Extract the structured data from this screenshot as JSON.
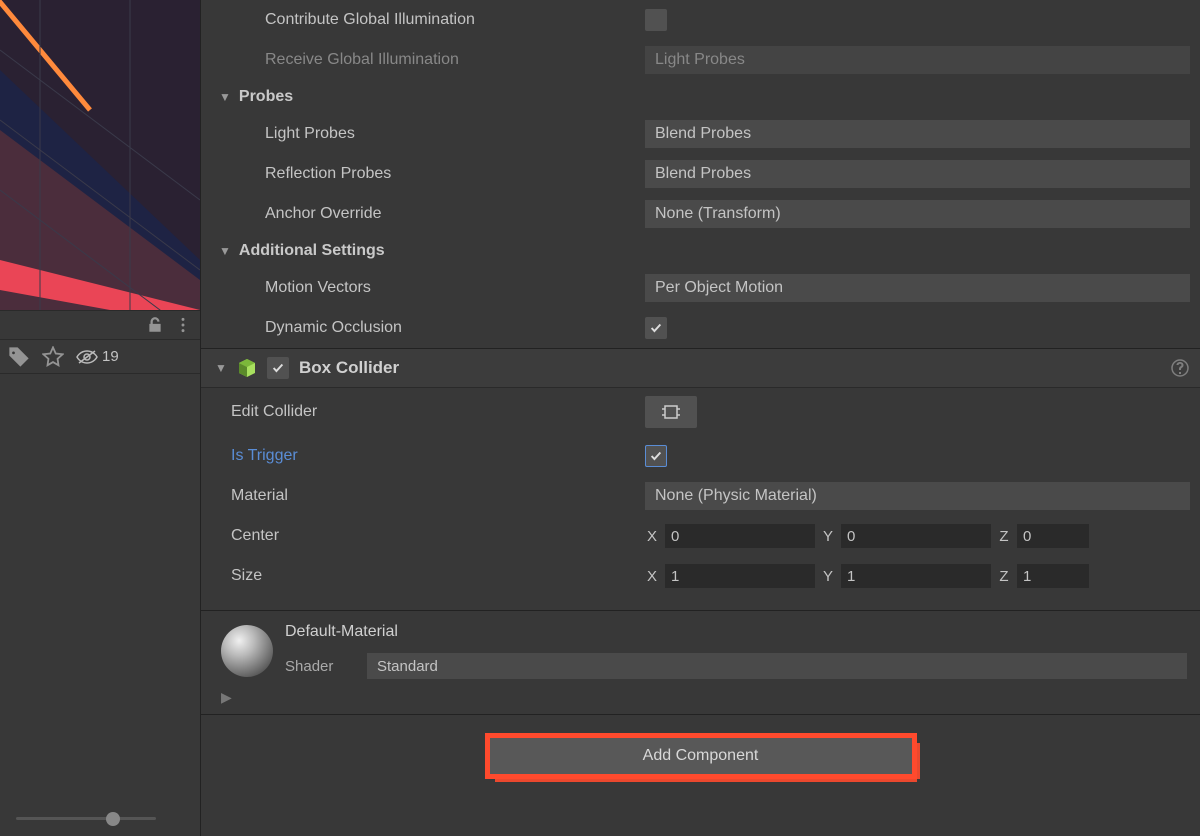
{
  "visibilityBadge": "19",
  "lighting": {
    "contributeGI": "Contribute Global Illumination",
    "receiveGI": "Receive Global Illumination",
    "receiveGIValue": "Light Probes"
  },
  "probes": {
    "title": "Probes",
    "lightProbes": {
      "label": "Light Probes",
      "value": "Blend Probes"
    },
    "reflectionProbes": {
      "label": "Reflection Probes",
      "value": "Blend Probes"
    },
    "anchorOverride": {
      "label": "Anchor Override",
      "value": "None (Transform)"
    }
  },
  "additional": {
    "title": "Additional Settings",
    "motionVectors": {
      "label": "Motion Vectors",
      "value": "Per Object Motion"
    },
    "dynamicOcclusion": {
      "label": "Dynamic Occlusion"
    }
  },
  "boxCollider": {
    "title": "Box Collider",
    "editCollider": "Edit Collider",
    "isTrigger": "Is Trigger",
    "material": {
      "label": "Material",
      "value": "None (Physic Material)"
    },
    "center": {
      "label": "Center",
      "x": "0",
      "y": "0",
      "z": "0"
    },
    "size": {
      "label": "Size",
      "x": "1",
      "y": "1",
      "z": "1"
    },
    "axisX": "X",
    "axisY": "Y",
    "axisZ": "Z"
  },
  "material": {
    "name": "Default-Material",
    "shaderLabel": "Shader",
    "shaderValue": "Standard"
  },
  "addComponent": "Add Component"
}
